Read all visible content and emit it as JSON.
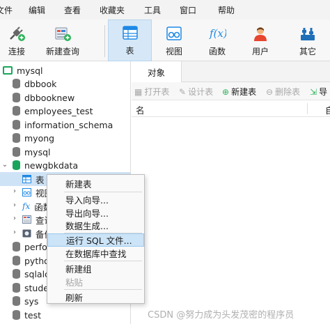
{
  "menubar": {
    "items": [
      "文件",
      "编辑",
      "查看",
      "收藏夹",
      "工具",
      "窗口",
      "帮助"
    ]
  },
  "toolbar": {
    "items": [
      {
        "label": "连接",
        "icon": "connect-plug-icon"
      },
      {
        "label": "新建查询",
        "icon": "new-query-icon"
      },
      {
        "label": "表",
        "icon": "table-icon"
      },
      {
        "label": "视图",
        "icon": "view-icon"
      },
      {
        "label": "函数",
        "icon": "function-icon"
      },
      {
        "label": "用户",
        "icon": "user-icon"
      },
      {
        "label": "其它",
        "icon": "tools-icon"
      }
    ],
    "active": "表",
    "accent": "#1e88e5"
  },
  "nav": {
    "connection": "mysql",
    "databases": [
      "dbbook",
      "dbbooknew",
      "employees_test",
      "information_schema",
      "myong",
      "mysql",
      "newgbkdata"
    ],
    "open_db_children": [
      "表",
      "视图",
      "函数",
      "查询",
      "备份"
    ],
    "more_databases": [
      "perfo",
      "pytho",
      "sqlalc",
      "stude",
      "sys",
      "test"
    ]
  },
  "main": {
    "tab": "对象",
    "object_toolbar": {
      "open_table": "打开表",
      "design_table": "设计表",
      "new_table": "新建表",
      "delete_table": "删除表",
      "import_export": "导"
    },
    "columns": [
      "名",
      "自"
    ]
  },
  "context_menu": {
    "items": [
      {
        "label": "新建表",
        "enabled": true
      },
      {
        "label": "导入向导...",
        "enabled": true
      },
      {
        "label": "导出向导...",
        "enabled": true
      },
      {
        "label": "数据生成...",
        "enabled": true
      },
      {
        "label": "运行 SQL 文件...",
        "enabled": true,
        "highlighted": true
      },
      {
        "label": "在数据库中查找",
        "enabled": true
      },
      {
        "label": "新建组",
        "enabled": true
      },
      {
        "label": "粘贴",
        "enabled": false
      },
      {
        "label": "刷新",
        "enabled": true
      }
    ]
  },
  "watermark": "CSDN @努力成为头发茂密的程序员"
}
